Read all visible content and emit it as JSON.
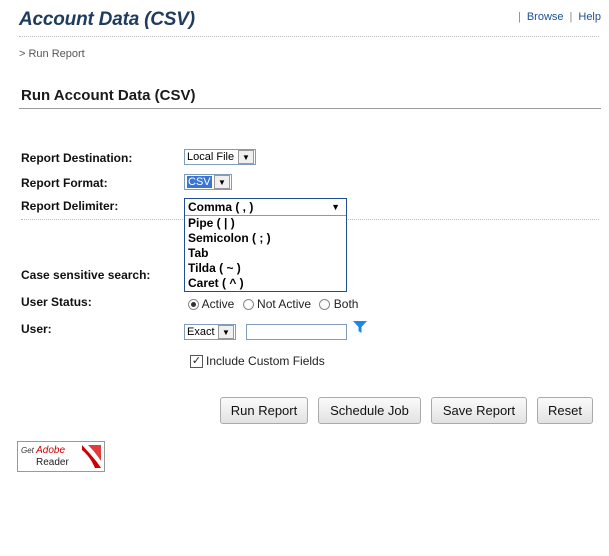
{
  "header": {
    "title": "Account Data (CSV)",
    "links": [
      "Browse",
      "Help"
    ]
  },
  "breadcrumb": "> Run Report",
  "section_title": "Run Account Data (CSV)",
  "form": {
    "destination_label": "Report Destination:",
    "destination_value": "Local File",
    "format_label": "Report Format:",
    "format_value": "CSV",
    "delimiter_label": "Report Delimiter:",
    "delimiter_value": "Comma ( , )",
    "delimiter_options": [
      "Pipe ( | )",
      "Semicolon ( ; )",
      "Tab",
      "Tilda  ( ~ )",
      "Caret ( ^ )"
    ],
    "case_label": "Case sensitive search:",
    "status_label": "User Status:",
    "status_options": [
      "Active",
      "Not Active",
      "Both"
    ],
    "status_selected": "Active",
    "user_label": "User:",
    "user_match": "Exact",
    "user_value": "",
    "custom_fields_label": "Include Custom Fields",
    "custom_fields_checked": true
  },
  "buttons": {
    "run": "Run Report",
    "schedule": "Schedule Job",
    "save": "Save Report",
    "reset": "Reset"
  },
  "adobe": {
    "get": "Get",
    "brand": "Adobe",
    "product": "Reader"
  },
  "colors": {
    "title": "#1f3c5e",
    "link": "#1f4f8f",
    "selection": "#3875d7",
    "filter_icon": "#1e88e5",
    "adobe_red": "#cc0000"
  }
}
